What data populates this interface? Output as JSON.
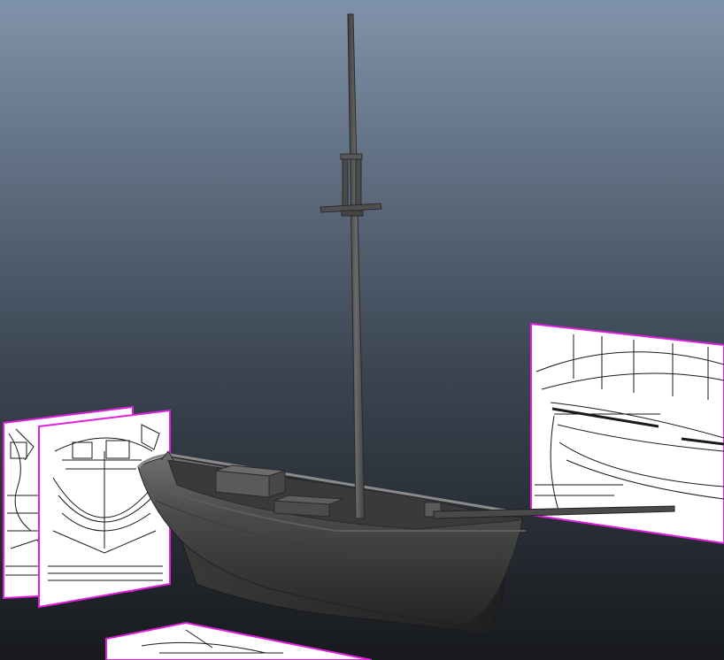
{
  "viewport": {
    "background_top": "#7f93aa",
    "background_mid": "#3c4653",
    "background_bottom": "#17191c"
  },
  "colors": {
    "selection_highlight": "#e020e0",
    "hull_dark": "#2b2b2b",
    "hull_mid": "#4a4a4a",
    "hull_light": "#707070",
    "mast": "#4f4f4f",
    "blueprint_paper": "#ffffff",
    "blueprint_ink": "#1a1a1a"
  },
  "scene": {
    "objects": [
      {
        "name": "ship-hull-model",
        "kind": "mesh"
      },
      {
        "name": "main-mast",
        "kind": "mesh"
      },
      {
        "name": "bowsprit",
        "kind": "mesh"
      },
      {
        "name": "blueprint-plane-front",
        "kind": "image-plane",
        "selected": true
      },
      {
        "name": "blueprint-plane-back",
        "kind": "image-plane",
        "selected": true
      },
      {
        "name": "blueprint-plane-side",
        "kind": "image-plane",
        "selected": true
      },
      {
        "name": "blueprint-plane-floor",
        "kind": "image-plane",
        "selected": true
      }
    ]
  }
}
